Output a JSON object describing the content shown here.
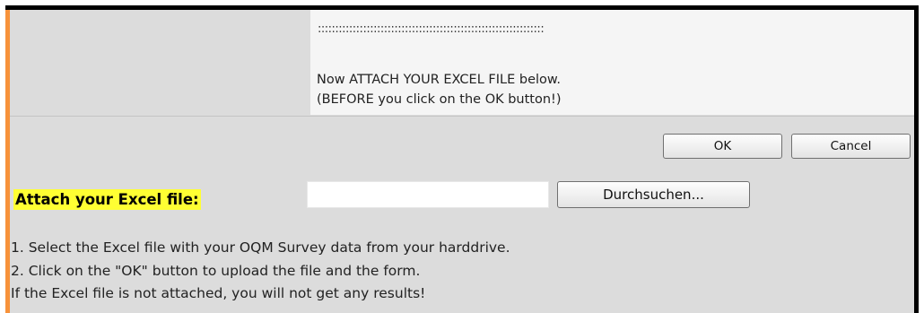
{
  "info_panel": {
    "dots": ":::::::::::::::::::::::::::::::::::::::::::::::::::::::::::::::::",
    "line1": "Now ATTACH YOUR EXCEL FILE below.",
    "line2": "(BEFORE you click on the OK button!)"
  },
  "buttons": {
    "ok_label": "OK",
    "cancel_label": "Cancel"
  },
  "attach": {
    "label": "Attach your Excel file:",
    "file_value": "",
    "browse_label": "Durchsuchen..."
  },
  "instructions": {
    "line1": "1. Select the Excel file with your OQM Survey data from your harddrive.",
    "line2": "2. Click on the \"OK\" button to upload the file and the form.",
    "line3": "If the Excel file is not attached, you will not get any results!"
  },
  "colors": {
    "accent": "#f7923a",
    "highlight": "#ffff33",
    "background": "#dcdcdc",
    "panel": "#f5f5f5"
  }
}
